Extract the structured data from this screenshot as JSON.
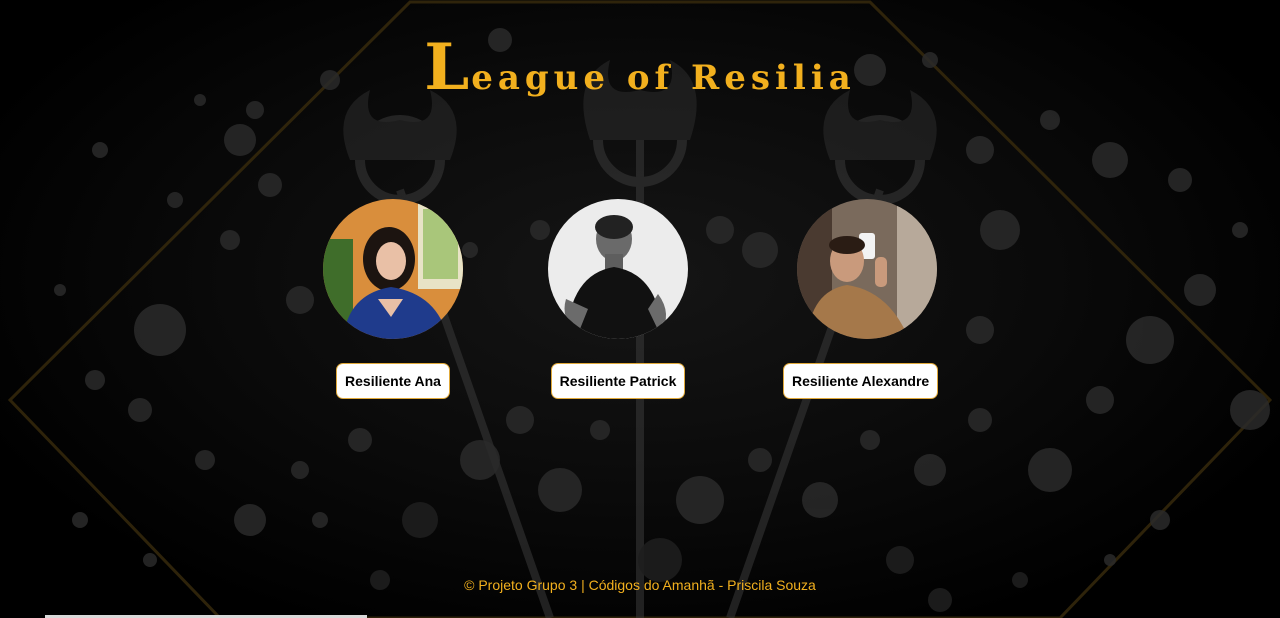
{
  "header": {
    "title_initial": "L",
    "title_rest": "eague of Resilia"
  },
  "profiles": [
    {
      "name": "Resiliente Ana"
    },
    {
      "name": "Resiliente Patrick"
    },
    {
      "name": "Resiliente Alexandre"
    }
  ],
  "footer": {
    "text": "© Projeto Grupo 3 | Códigos do Amanhã - Priscila Souza"
  },
  "colors": {
    "accent": "#f2b01e",
    "background": "#000000",
    "button_bg": "#ffffff",
    "button_border": "#e0a93a"
  }
}
